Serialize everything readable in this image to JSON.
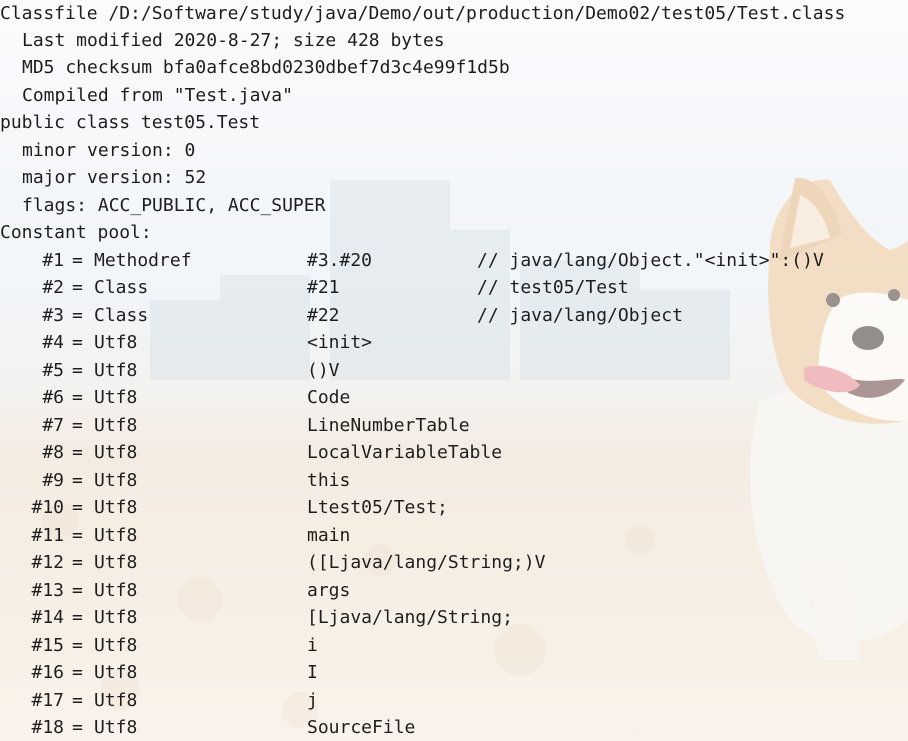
{
  "header": {
    "classfile": "Classfile /D:/Software/study/java/Demo/out/production/Demo02/test05/Test.class",
    "last_modified": "Last modified 2020-8-27; size 428 bytes",
    "md5": "MD5 checksum bfa0afce8bd0230dbef7d3c4e99f1d5b",
    "compiled_from": "Compiled from \"Test.java\"",
    "class_decl": "public class test05.Test",
    "minor_version": "minor version: 0",
    "major_version": "major version: 52",
    "flags": "flags: ACC_PUBLIC, ACC_SUPER",
    "constant_pool_label": "Constant pool:"
  },
  "constant_pool": [
    {
      "index": "#1",
      "eq": "=",
      "type": "Methodref",
      "value": "#3.#20",
      "comment": "// java/lang/Object.\"<init>\":()V"
    },
    {
      "index": "#2",
      "eq": "=",
      "type": "Class",
      "value": "#21",
      "comment": "// test05/Test"
    },
    {
      "index": "#3",
      "eq": "=",
      "type": "Class",
      "value": "#22",
      "comment": "// java/lang/Object"
    },
    {
      "index": "#4",
      "eq": "=",
      "type": "Utf8",
      "value": "<init>",
      "comment": ""
    },
    {
      "index": "#5",
      "eq": "=",
      "type": "Utf8",
      "value": "()V",
      "comment": ""
    },
    {
      "index": "#6",
      "eq": "=",
      "type": "Utf8",
      "value": "Code",
      "comment": ""
    },
    {
      "index": "#7",
      "eq": "=",
      "type": "Utf8",
      "value": "LineNumberTable",
      "comment": ""
    },
    {
      "index": "#8",
      "eq": "=",
      "type": "Utf8",
      "value": "LocalVariableTable",
      "comment": ""
    },
    {
      "index": "#9",
      "eq": "=",
      "type": "Utf8",
      "value": "this",
      "comment": ""
    },
    {
      "index": "#10",
      "eq": "=",
      "type": "Utf8",
      "value": "Ltest05/Test;",
      "comment": ""
    },
    {
      "index": "#11",
      "eq": "=",
      "type": "Utf8",
      "value": "main",
      "comment": ""
    },
    {
      "index": "#12",
      "eq": "=",
      "type": "Utf8",
      "value": "([Ljava/lang/String;)V",
      "comment": ""
    },
    {
      "index": "#13",
      "eq": "=",
      "type": "Utf8",
      "value": "args",
      "comment": ""
    },
    {
      "index": "#14",
      "eq": "=",
      "type": "Utf8",
      "value": "[Ljava/lang/String;",
      "comment": ""
    },
    {
      "index": "#15",
      "eq": "=",
      "type": "Utf8",
      "value": "i",
      "comment": ""
    },
    {
      "index": "#16",
      "eq": "=",
      "type": "Utf8",
      "value": "I",
      "comment": ""
    },
    {
      "index": "#17",
      "eq": "=",
      "type": "Utf8",
      "value": "j",
      "comment": ""
    },
    {
      "index": "#18",
      "eq": "=",
      "type": "Utf8",
      "value": "SourceFile",
      "comment": ""
    }
  ],
  "theme": {
    "text_color": "#1e1e1e",
    "background_image": "beach-corgi-wallpaper"
  }
}
